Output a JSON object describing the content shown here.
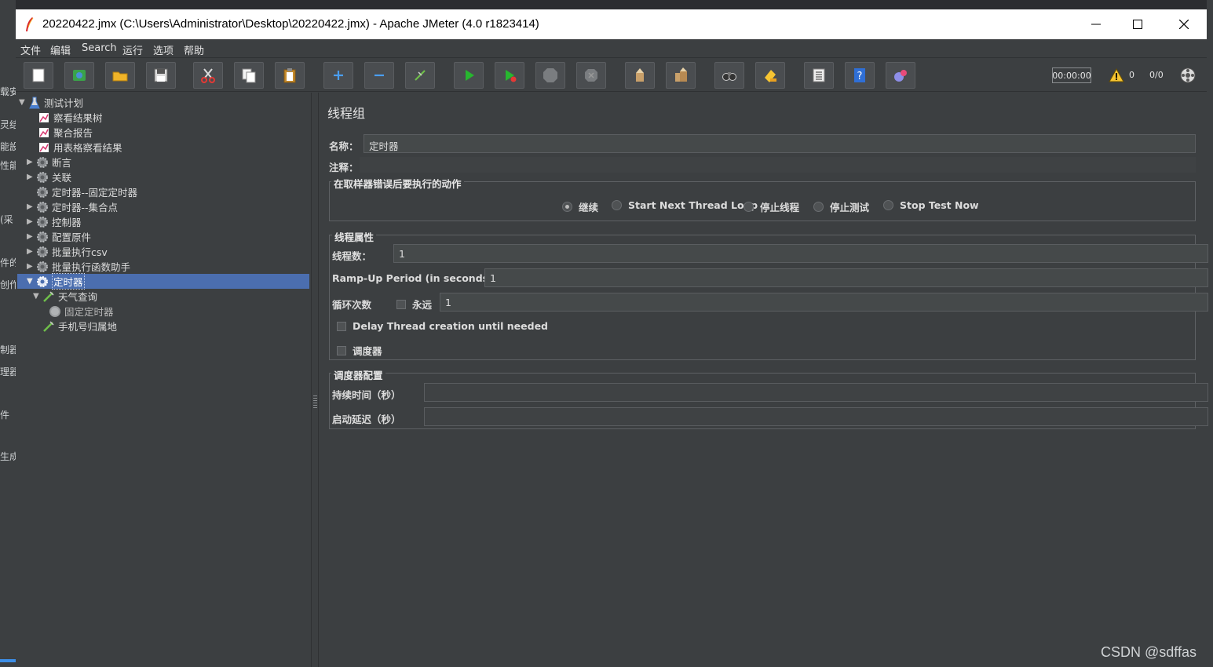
{
  "background": {
    "left_fragments": [
      "载安",
      "灵结",
      "能設",
      "性能",
      "(采",
      "件的",
      "创作",
      "制器",
      "理器",
      "件",
      "生成"
    ],
    "top_fragment": "定时器"
  },
  "window": {
    "title": "20220422.jmx (C:\\Users\\Administrator\\Desktop\\20220422.jmx) - Apache JMeter (4.0 r1823414)",
    "controls": [
      "minimize",
      "maximize",
      "close"
    ]
  },
  "menu": [
    "文件",
    "编辑",
    "Search",
    "运行",
    "选项",
    "帮助"
  ],
  "toolbar": {
    "buttons": [
      {
        "name": "new-icon"
      },
      {
        "name": "templates-icon"
      },
      {
        "name": "open-icon"
      },
      {
        "name": "save-icon"
      },
      {
        "name": "cut-icon"
      },
      {
        "name": "copy-icon"
      },
      {
        "name": "paste-icon"
      },
      {
        "name": "expand-icon"
      },
      {
        "name": "collapse-icon"
      },
      {
        "name": "toggle-icon"
      },
      {
        "name": "start-icon"
      },
      {
        "name": "start-no-pauses-icon"
      },
      {
        "name": "stop-icon"
      },
      {
        "name": "shutdown-icon"
      },
      {
        "name": "clear-icon"
      },
      {
        "name": "clear-all-icon"
      },
      {
        "name": "search-icon"
      },
      {
        "name": "reset-search-icon"
      },
      {
        "name": "function-helper-icon"
      },
      {
        "name": "help-icon"
      },
      {
        "name": "remote-icon"
      }
    ],
    "timer": "00:00:00",
    "warning_count": "0",
    "threads": "0/0"
  },
  "tree": {
    "nodes": [
      {
        "label": "测试计划",
        "icon": "test-plan-icon",
        "expanded": true,
        "level": 0
      },
      {
        "label": "察看结果树",
        "icon": "listener-icon",
        "level": 1
      },
      {
        "label": "聚合报告",
        "icon": "listener-icon",
        "level": 1
      },
      {
        "label": "用表格察看结果",
        "icon": "listener-icon",
        "level": 1
      },
      {
        "label": "断言",
        "icon": "thread-group-icon",
        "collapsed": true,
        "level": 1
      },
      {
        "label": "关联",
        "icon": "thread-group-icon",
        "collapsed": true,
        "level": 1
      },
      {
        "label": "定时器--固定定时器",
        "icon": "thread-group-icon",
        "level": 1
      },
      {
        "label": "定时器--集合点",
        "icon": "thread-group-icon",
        "collapsed": true,
        "level": 1
      },
      {
        "label": "控制器",
        "icon": "thread-group-icon",
        "collapsed": true,
        "level": 1
      },
      {
        "label": "配置原件",
        "icon": "thread-group-icon",
        "collapsed": true,
        "level": 1
      },
      {
        "label": "批量执行csv",
        "icon": "thread-group-icon",
        "collapsed": true,
        "level": 1
      },
      {
        "label": "批量执行函数助手",
        "icon": "thread-group-icon",
        "collapsed": true,
        "level": 1
      },
      {
        "label": "定时器",
        "icon": "thread-group-icon",
        "expanded": true,
        "selected": true,
        "level": 1
      },
      {
        "label": "天气查询",
        "icon": "sampler-icon",
        "expanded": true,
        "level": 2
      },
      {
        "label": "固定定时器",
        "icon": "timer-icon",
        "level": 3
      },
      {
        "label": "手机号归属地",
        "icon": "sampler-icon",
        "level": 2
      }
    ]
  },
  "panel": {
    "title": "线程组",
    "name_label": "名称：",
    "name_value": "定时器",
    "comment_label": "注释：",
    "comment_value": "",
    "error_group": {
      "title": "在取样器错误后要执行的动作",
      "options": [
        "继续",
        "Start Next Thread Loop",
        "停止线程",
        "停止测试",
        "Stop Test Now"
      ],
      "selected": "继续"
    },
    "thread_props": {
      "title": "线程属性",
      "threads_label": "线程数：",
      "threads_value": "1",
      "rampup_label": "Ramp-Up Period (in seconds):",
      "rampup_value": "1",
      "loop_label": "循环次数",
      "forever_label": "永远",
      "forever_checked": false,
      "loop_value": "1",
      "delay_label": "Delay Thread creation until needed",
      "delay_checked": false,
      "scheduler_label": "调度器",
      "scheduler_checked": false
    },
    "scheduler_config": {
      "title": "调度器配置",
      "duration_label": "持续时间（秒）",
      "duration_value": "",
      "delay_label": "启动延迟（秒）",
      "delay_value": ""
    }
  },
  "watermark": "CSDN @sdffas"
}
